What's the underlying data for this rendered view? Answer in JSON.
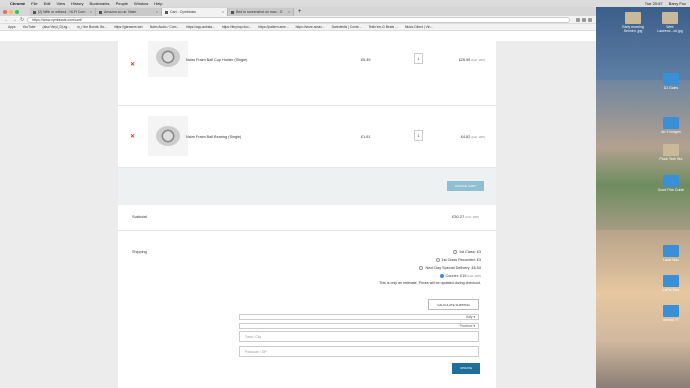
{
  "menubar": {
    "app": "Chrome",
    "items": [
      "File",
      "Edit",
      "View",
      "History",
      "Bookmarks",
      "People",
      "Window",
      "Help"
    ],
    "clock": "Tue 20:57",
    "user": "Barry Fox"
  },
  "tabs": [
    {
      "label": "(2) With or without - Hi-Fi Corn"
    },
    {
      "label": "Amazon.co.uk: Naim"
    },
    {
      "label": "Cart - Cymbiosis"
    },
    {
      "label": "Bed to screenshot on mac - G"
    }
  ],
  "address": {
    "url": "https://www.cymbiosis.com/cart/"
  },
  "bookmarks": [
    "Apps",
    "YouTube",
    "(also Vinyl_Dj ag...",
    "m_r the Bonds: Bo...",
    "https://gbrasers.we/",
    "Naim Audio / Com...",
    "https://app.anksta...",
    "https://tinyriop.dux...",
    "https://pattern.ame...",
    "https://store.amaz...",
    "Daredevils | Conte...",
    "Tekin'em G Beats ...",
    "Music Direct | Vin..."
  ],
  "cart": {
    "items": [
      {
        "remove": "✕",
        "name": "Naim Fraim Ball Cup Holder (Single)",
        "price": "£6.49",
        "qty": "1",
        "total": "£25.95",
        "total_note": "(incl. VAT)"
      },
      {
        "remove": "✕",
        "name": "Naim Fraim Ball Bearing (Single)",
        "price": "£1.61",
        "qty": "1",
        "total": "£4.82",
        "total_note": "(incl. VAT)"
      }
    ],
    "update_button": "UPDATE CART",
    "subtotal_label": "Subtotal",
    "subtotal_value": "£30.27",
    "subtotal_note": "(incl. VAT)",
    "shipping_label": "Shipping",
    "shipping_options": [
      {
        "label": "1st Class: £3",
        "checked": false,
        "note": ""
      },
      {
        "label": "1st Class Recorded: £3",
        "checked": false,
        "note": ""
      },
      {
        "label": "Next Day Special Delivery: £6.54",
        "checked": false,
        "note": ""
      },
      {
        "label": "Courier: £15",
        "checked": true,
        "note": "(incl. VAT)"
      }
    ],
    "estimate_note": "This is only an estimate. Prices will be updated during checkout.",
    "calc_button": "CALCULATE SHIPPING",
    "country": "Italy",
    "province": "Province",
    "city_placeholder": "Town / City",
    "postcode_placeholder": "Postcode / ZIP",
    "update_shipping_button": "UPDATE"
  },
  "desktop_icons": [
    {
      "label": "Early morning Sennen..jpg",
      "type": "img"
    },
    {
      "label": "Web Lawrenc...ok.jpg",
      "type": "img"
    },
    {
      "label": "DJ Gales",
      "type": "folder"
    },
    {
      "label": "Air 2 Images",
      "type": "folder"
    },
    {
      "label": "Plock Tech Bur",
      "type": "img"
    },
    {
      "label": "Good Film Guide",
      "type": "folder"
    },
    {
      "label": "Lacie Mac",
      "type": "folder"
    },
    {
      "label": "LaCie Mac",
      "type": "folder"
    },
    {
      "label": "Amelia YT",
      "type": "folder"
    }
  ]
}
